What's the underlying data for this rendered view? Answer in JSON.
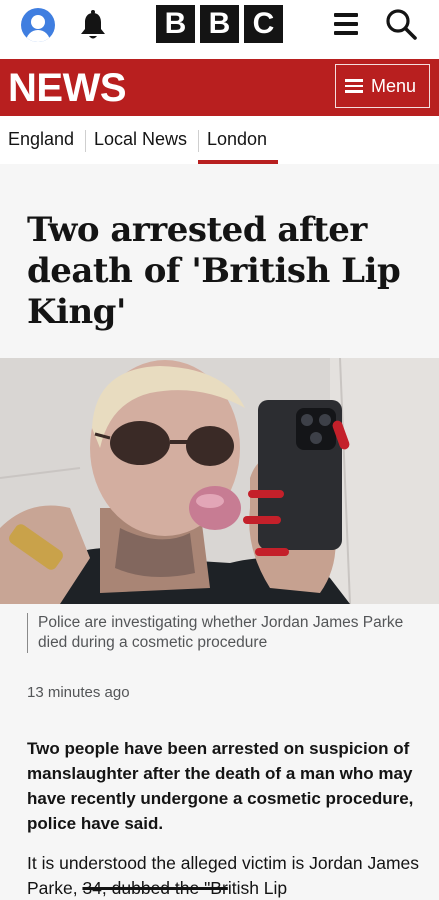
{
  "header": {
    "account_icon": "account-icon",
    "notifications_icon": "bell-icon",
    "logo_letters": [
      "B",
      "B",
      "C"
    ],
    "menu_icon": "hamburger-icon",
    "search_icon": "search-icon"
  },
  "banner": {
    "title": "NEWS",
    "menu_label": "Menu",
    "color": "#b81f1f"
  },
  "section_nav": {
    "items": [
      "England",
      "Local News",
      "London"
    ],
    "active": "London"
  },
  "article": {
    "headline": "Two arrested after death of 'British Lip King'",
    "image_caption": "Police are investigating whether Jordan James Parke died during a cosmetic procedure",
    "timestamp": "13 minutes ago",
    "lead": "Two people have been arrested on suspicion of manslaughter after the death of a man who may have recently undergone a cosmetic procedure, police have said.",
    "para_start": "It is understood the alleged victim is Jordan James Parke, ",
    "para_struck": "34, dubbed the \"Br",
    "para_end": "itish Lip"
  }
}
